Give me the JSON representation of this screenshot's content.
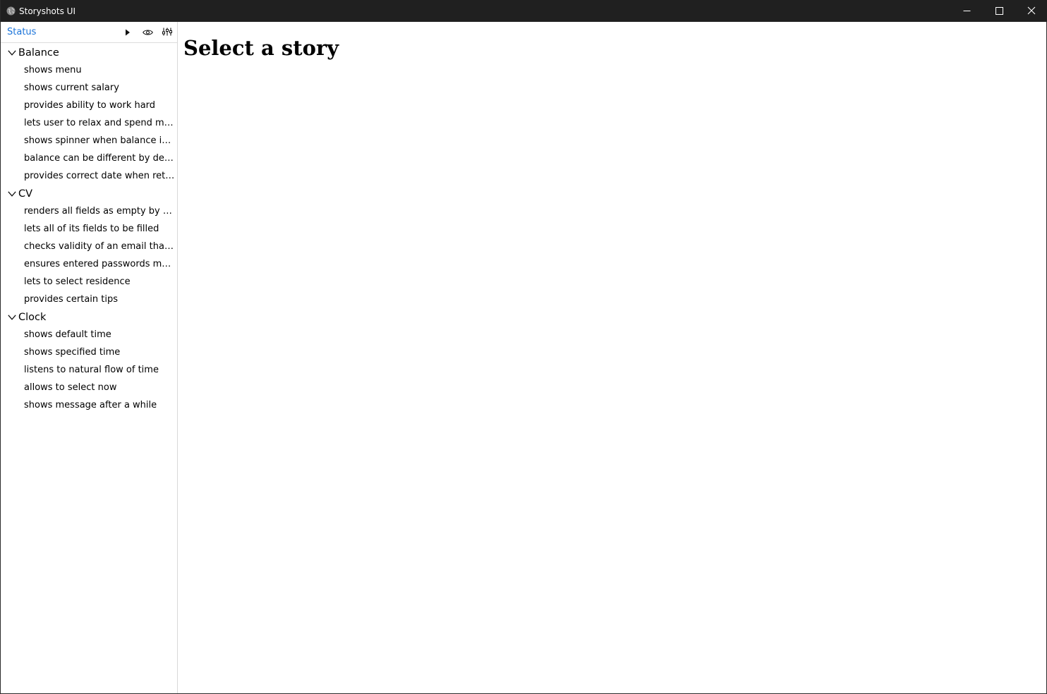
{
  "window": {
    "title": "Storyshots UI",
    "app_icon": "globe-icon"
  },
  "toolbar": {
    "status_label": "Status",
    "icons": [
      "play-icon",
      "eye-icon",
      "sliders-icon"
    ]
  },
  "tree": {
    "groups": [
      {
        "title": "Balance",
        "expanded": true,
        "stories": [
          "shows menu",
          "shows current salary",
          "provides ability to work hard",
          "lets user to relax and spend money",
          "shows spinner when balance is not loaded",
          "balance can be different by default",
          "provides correct date when retrieving"
        ]
      },
      {
        "title": "CV",
        "expanded": true,
        "stories": [
          "renders all fields as empty by default",
          "lets all of its fields to be filled",
          "checks validity of an email that was entered",
          "ensures entered passwords match",
          "lets to select residence",
          "provides certain tips"
        ]
      },
      {
        "title": "Clock",
        "expanded": true,
        "stories": [
          "shows default time",
          "shows specified time",
          "listens to natural flow of time",
          "allows to select now",
          "shows message after a while"
        ]
      }
    ]
  },
  "main": {
    "heading": "Select a story"
  },
  "colors": {
    "titlebar_bg": "#202020",
    "status_link": "#1a73d9",
    "divider": "#d9d9d9"
  }
}
